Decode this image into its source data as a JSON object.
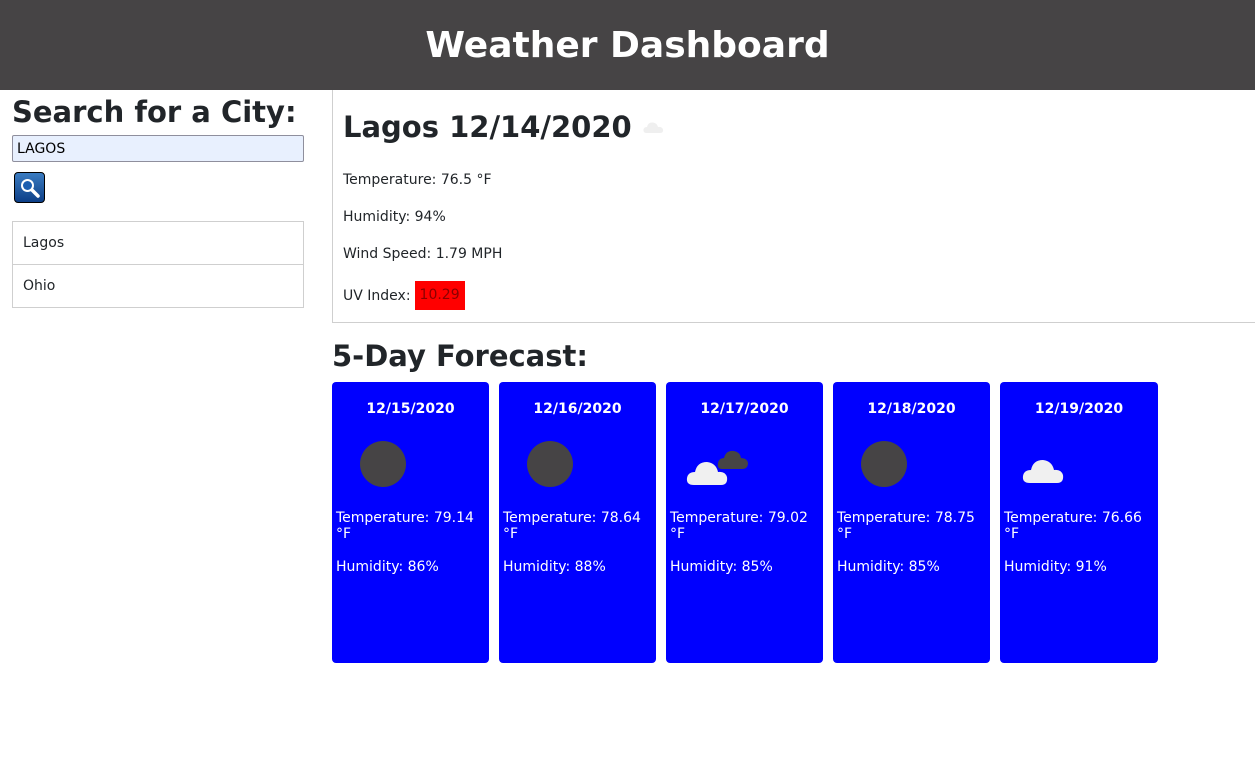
{
  "header": {
    "title": "Weather Dashboard"
  },
  "search": {
    "heading": "Search for a City:",
    "input_value": "LAGOS",
    "history": [
      "Lagos",
      "Ohio"
    ]
  },
  "current": {
    "city_date": "Lagos 12/14/2020",
    "icon": "cloud-icon",
    "temperature": "Temperature: 76.5 °F",
    "humidity": "Humidity: 94%",
    "wind": "Wind Speed: 1.79 MPH",
    "uv_label": "UV Index:",
    "uv_value": "10.29",
    "uv_color": "#ff0000"
  },
  "forecast": {
    "title": "5-Day Forecast:",
    "card_color": "#0000ff",
    "days": [
      {
        "date": "12/15/2020",
        "icon": "dark-circle-icon",
        "temp": "Temperature: 79.14 °F",
        "humidity": "Humidity: 86%"
      },
      {
        "date": "12/16/2020",
        "icon": "dark-circle-icon",
        "temp": "Temperature: 78.64 °F",
        "humidity": "Humidity: 88%"
      },
      {
        "date": "12/17/2020",
        "icon": "broken-clouds-icon",
        "temp": "Temperature: 79.02 °F",
        "humidity": "Humidity: 85%"
      },
      {
        "date": "12/18/2020",
        "icon": "dark-circle-icon",
        "temp": "Temperature: 78.75 °F",
        "humidity": "Humidity: 85%"
      },
      {
        "date": "12/19/2020",
        "icon": "cloud-icon",
        "temp": "Temperature: 76.66 °F",
        "humidity": "Humidity: 91%"
      }
    ]
  }
}
